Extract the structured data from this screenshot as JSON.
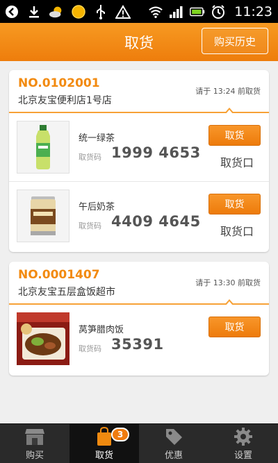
{
  "status_bar": {
    "time": "11:23",
    "icons": [
      "usb-debug-icon",
      "download-icon",
      "weather-icon",
      "sun-icon",
      "usb-icon",
      "warning-icon",
      "wifi-icon",
      "signal-icon",
      "battery-icon",
      "alarm-icon"
    ]
  },
  "header": {
    "title": "取货",
    "history_button": "购买历史"
  },
  "orders": [
    {
      "order_no": "NO.0102001",
      "store": "北京友宝便利店1号店",
      "deadline": "请于 13:24 前取货",
      "items": [
        {
          "name": "统一绿茶",
          "code_label": "取货码",
          "code": "1999 4653",
          "button": "取货",
          "window": "取货口"
        },
        {
          "name": "午后奶茶",
          "code_label": "取货码",
          "code": "4409 4645",
          "button": "取货",
          "window": "取货口"
        }
      ]
    },
    {
      "order_no": "NO.0001407",
      "store": "北京友宝五层盒饭超市",
      "deadline": "请于 13:30 前取货",
      "items": [
        {
          "name": "莴笋腊肉饭",
          "code_label": "取货码",
          "code": "35391",
          "button": "取货"
        }
      ]
    }
  ],
  "bottom_nav": {
    "tabs": [
      {
        "label": "购买",
        "icon": "store-icon"
      },
      {
        "label": "取货",
        "icon": "shopping-bag-icon",
        "badge": "3",
        "active": true
      },
      {
        "label": "优惠",
        "icon": "tag-icon"
      },
      {
        "label": "设置",
        "icon": "gear-icon"
      }
    ]
  },
  "colors": {
    "accent": "#f28a10",
    "nav_bg": "#2a2a2a",
    "status_bg": "#000000"
  }
}
